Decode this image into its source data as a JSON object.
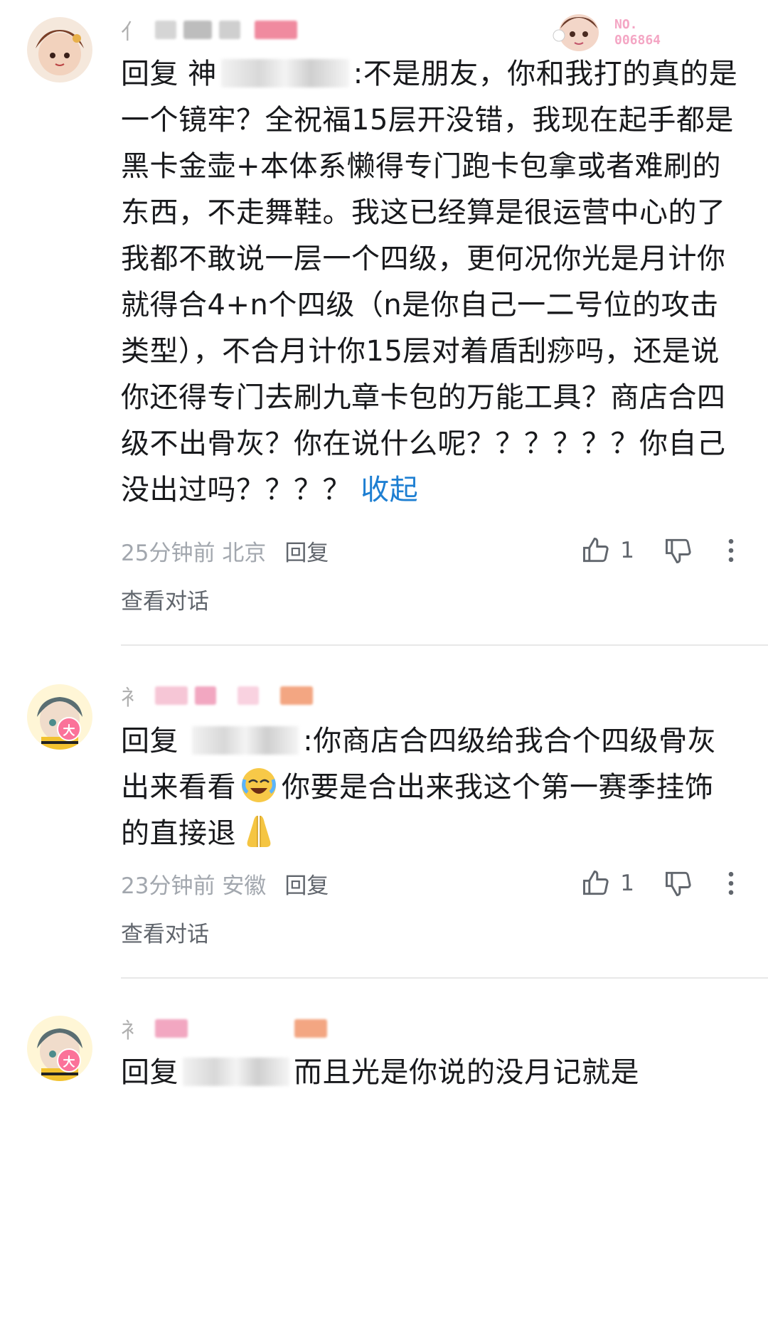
{
  "badge": {
    "text": "NO.\n006864",
    "line1": "NO.",
    "line2": "006864"
  },
  "comments": [
    {
      "reply_prefix": "回复 神",
      "body_after_mention": ":不是朋友，你和我打的真的是一个镜牢？全祝福15层开没错，我现在起手都是黑卡金壶+本体系懒得专门跑卡包拿或者难刷的东西，不走舞鞋。我这已经算是很运营中心的了我都不敢说一层一个四级，更何况你光是月计你就得合4+n个四级（n是你自己一二号位的攻击类型），不合月计你15层对着盾刮痧吗，还是说你还得专门去刷九章卡包的万能工具？商店合四级不出骨灰？你在说什么呢？？？？？？你自己没出过吗？？？？",
      "collapse_label": "收起",
      "time": "25分钟前",
      "location": "北京",
      "reply_label": "回复",
      "likes": "1",
      "view_conversation": "查看对话"
    },
    {
      "reply_prefix": "回复 ",
      "body_after_mention_1": ":你商店合四级给我合个四级骨灰出来看看",
      "body_after_mention_2": "你要是合出来我这个第一赛季挂饰的直接退",
      "level_badge": "大",
      "time": "23分钟前",
      "location": "安徽",
      "reply_label": "回复",
      "likes": "1",
      "view_conversation": "查看对话"
    },
    {
      "reply_prefix": "回复",
      "body_after_mention": "而且光是你说的没月记就是",
      "level_badge": "大"
    }
  ],
  "icons": {
    "like": "thumbs-up-icon",
    "dislike": "thumbs-down-icon",
    "more": "more-vertical-icon",
    "laugh_emoji": "laughing-crying-emoji",
    "pray_emoji": "praying-hands-emoji"
  },
  "colors": {
    "link": "#1e7fd2",
    "meta_gray": "#a2a7ae",
    "action_gray": "#61666d",
    "badge_pink": "#fb7299"
  }
}
